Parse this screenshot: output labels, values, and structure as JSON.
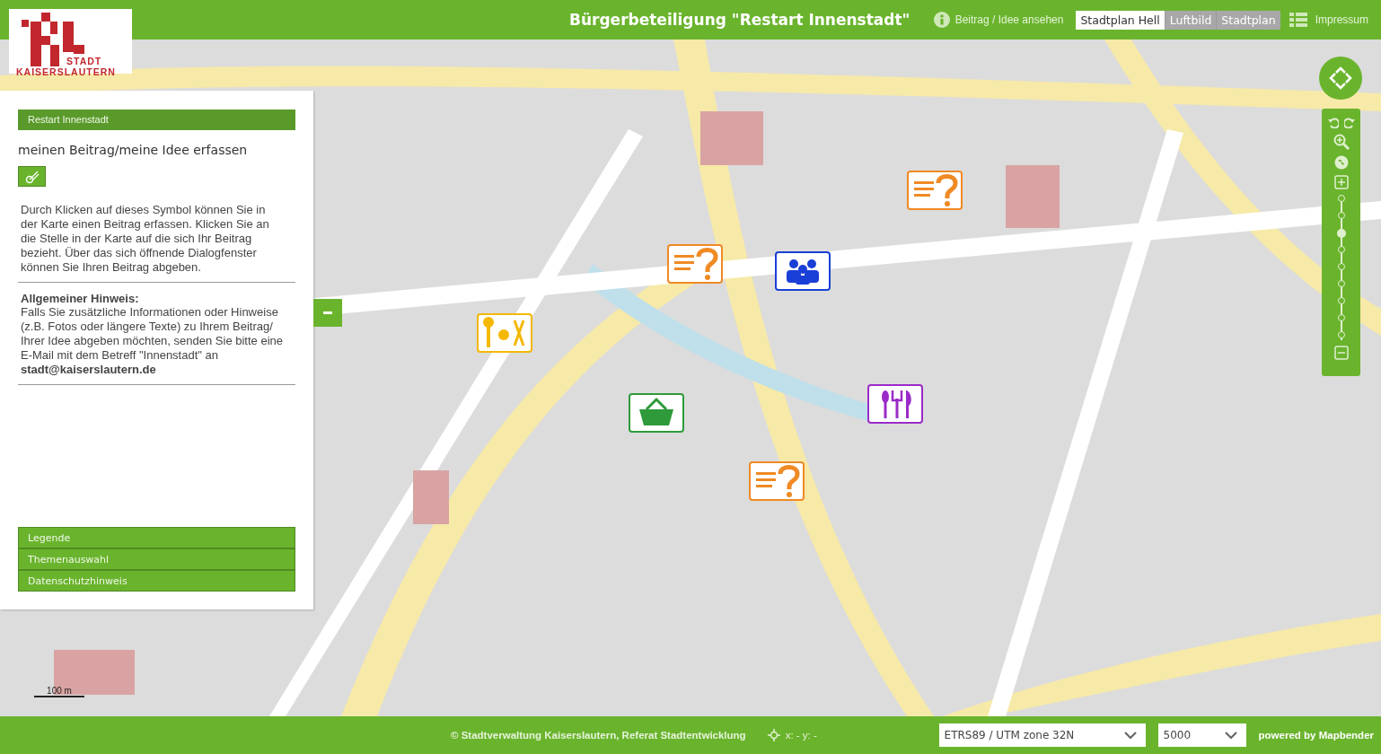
{
  "logo": {
    "line_1": "STADT",
    "line_2": "KAISERSLAUTERN"
  },
  "header": {
    "title": "Bürgerbeteiligung \"Restart Innenstadt\"",
    "info_link": "Beitrag / Idee ansehen",
    "basemaps": [
      {
        "label": "Stadtplan Hell",
        "selected": true
      },
      {
        "label": "Luftbild",
        "selected": false
      },
      {
        "label": "Stadtplan",
        "selected": false
      }
    ],
    "impressum": "Impressum"
  },
  "panel": {
    "heading": "Restart Innenstadt",
    "subtitle": "meinen Beitrag/meine Idee erfassen",
    "instructions": "Durch Klicken auf dieses Symbol können Sie in der Karte einen Beitrag erfassen. Klicken Sie an die Stelle in der Karte auf die sich Ihr Beitrag bezieht. Über das sich öffnende Dialogfenster können Sie Ihren Beitrag abgeben.",
    "notice_title": "Allgemeiner Hinweis:",
    "notice": "Falls Sie zusätzliche Informationen oder Hinweise (z.B. Fotos oder längere Texte) zu Ihrem Beitrag/ Ihrer Idee abgeben möchten, senden Sie bitte eine E-Mail mit dem Betreff \"Innenstadt\" an **stadt@kaiserslautern.de**",
    "accordion": [
      {
        "label": "Legende"
      },
      {
        "label": "Themenauswahl"
      },
      {
        "label": "Datenschutzhinweis"
      }
    ]
  },
  "map": {
    "kind": "picture",
    "markers": [
      {
        "kind": "question",
        "color": "#f08a24"
      },
      {
        "kind": "question",
        "color": "#f08a24"
      },
      {
        "kind": "question",
        "color": "#f08a24"
      },
      {
        "kind": "tools",
        "color": "#f5b800"
      },
      {
        "kind": "people",
        "color": "#1a3fd6"
      },
      {
        "kind": "basket",
        "color": "#2e9a3a"
      },
      {
        "kind": "cutlery",
        "color": "#9b2bc8"
      }
    ],
    "scale_bar": "100 m"
  },
  "zoom": {
    "level": 0.75
  },
  "footer": {
    "copyright": "© Stadtverwaltung Kaiserslautern, Referat Stadtentwicklung",
    "coordinates": "x: - y: -",
    "crs": "ETRS89 / UTM zone 32N",
    "scale": "5000",
    "powered": "powered by Mapbender"
  }
}
